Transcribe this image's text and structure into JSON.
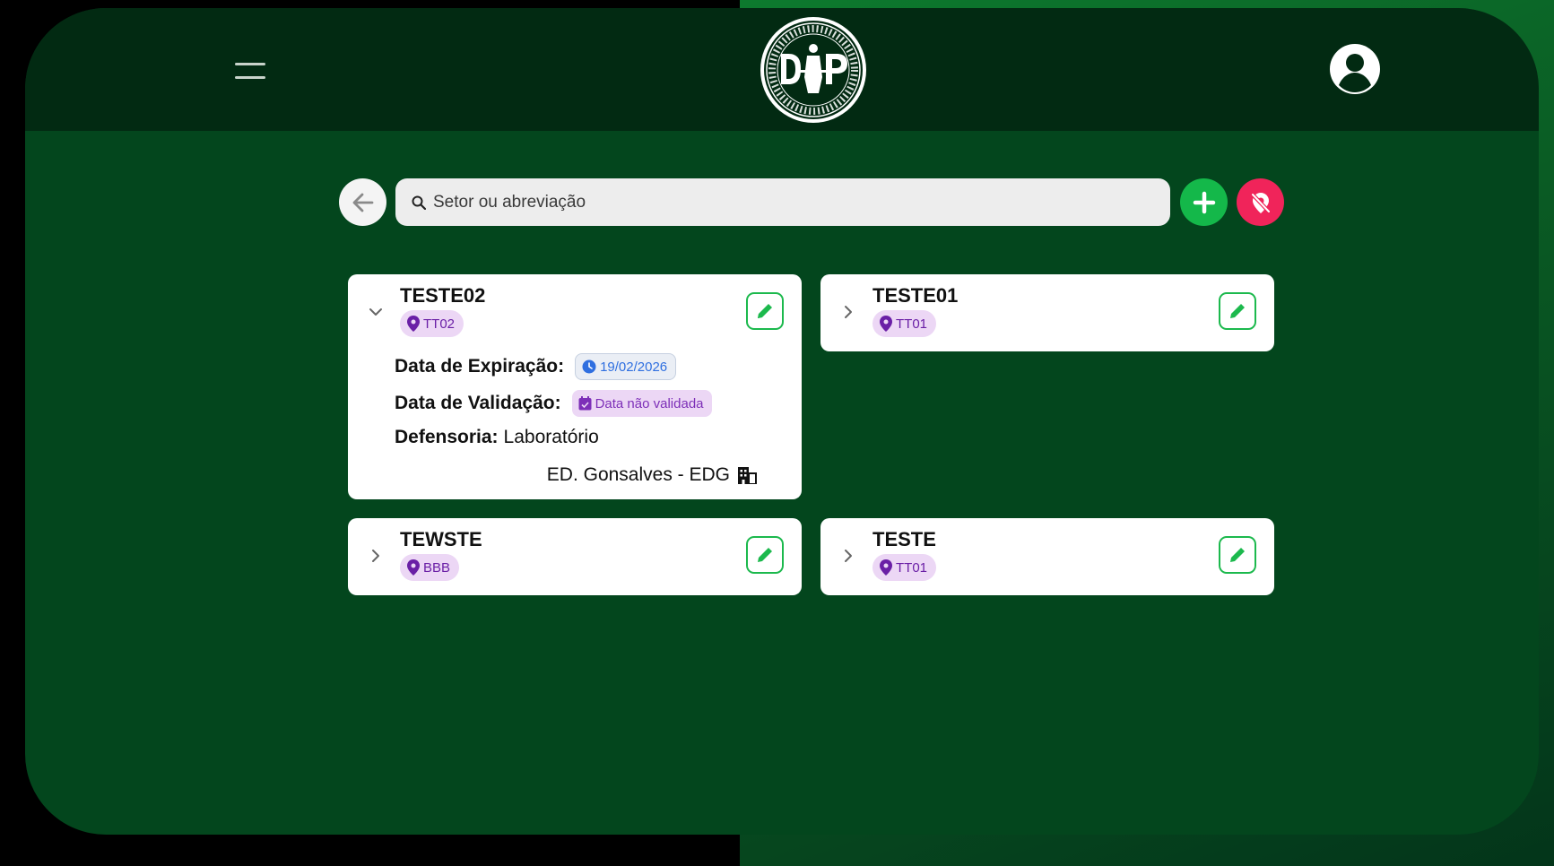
{
  "search": {
    "placeholder": "Setor ou abreviação"
  },
  "cards": [
    {
      "title": "TESTE02",
      "tag": "TT02",
      "expanded": true,
      "expiration_label": "Data de Expiração:",
      "expiration_value": "19/02/2026",
      "validation_label": "Data de Validação:",
      "validation_value": "Data não validada",
      "defensoria_label": "Defensoria:",
      "defensoria_value": "Laboratório",
      "building": "ED. Gonsalves - EDG"
    },
    {
      "title": "TESTE01",
      "tag": "TT01",
      "expanded": false
    },
    {
      "title": "TEWSTE",
      "tag": "BBB",
      "expanded": false
    },
    {
      "title": "TESTE",
      "tag": "TT01",
      "expanded": false
    }
  ],
  "colors": {
    "background": "#03461d",
    "header": "#022a12",
    "add_button": "#14b84a",
    "off_button": "#f0245a",
    "tag_bg": "#ecd7f5",
    "tag_text": "#6a1fa6",
    "edit_border": "#1cb94d",
    "date_text": "#2f6fe0"
  },
  "icons": [
    "menu-icon",
    "logo-seal",
    "user-avatar-icon",
    "arrow-left-icon",
    "search-icon",
    "plus-icon",
    "location-off-icon",
    "chevron-down-icon",
    "chevron-right-icon",
    "map-pin-icon",
    "pencil-icon",
    "clock-icon",
    "calendar-check-icon",
    "building-icon"
  ]
}
